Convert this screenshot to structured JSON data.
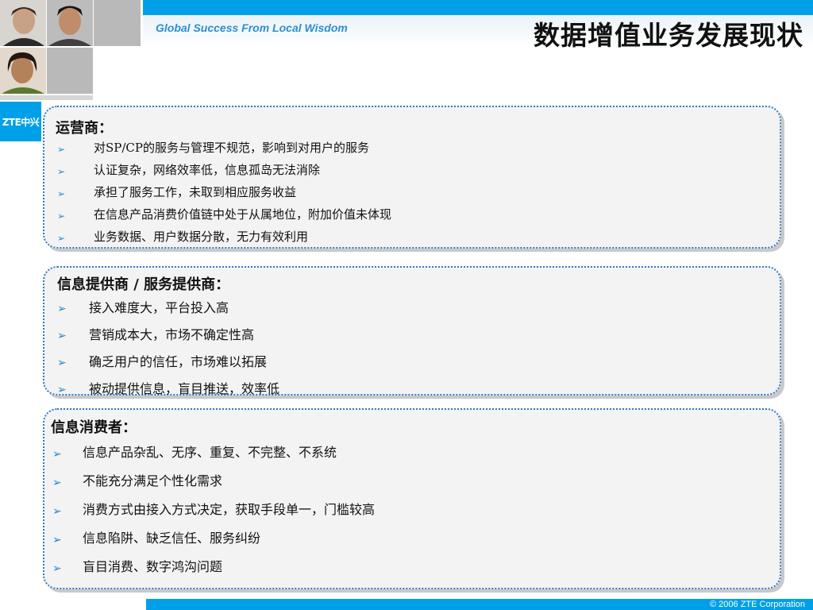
{
  "header": {
    "slogan": "Global Success From Local Wisdom",
    "title": "数据增值业务发展现状",
    "logo_text": "ZTE中兴"
  },
  "panels": [
    {
      "title": "运营商：",
      "items": [
        "对SP/CP的服务与管理不规范，影响到对用户的服务",
        "认证复杂，网络效率低，信息孤岛无法消除",
        "承担了服务工作，未取到相应服务收益",
        "在信息产品消费价值链中处于从属地位，附加价值未体现",
        "业务数据、用户数据分散，无力有效利用"
      ]
    },
    {
      "title": "信息提供商 / 服务提供商：",
      "items": [
        "接入难度大，平台投入高",
        "营销成本大，市场不确定性高",
        "确乏用户的信任，市场难以拓展",
        "被动提供信息，盲目推送，效率低"
      ]
    },
    {
      "title": "信息消费者：",
      "items": [
        "信息产品杂乱、无序、重复、不完整、不系统",
        "不能充分满足个性化需求",
        "消费方式由接入方式决定，获取手段单一，门槛较高",
        "信息陷阱、缺乏信任、服务纠纷",
        "盲目消费、数字鸿沟问题"
      ]
    }
  ],
  "bullet_glyph": "➢",
  "footer": {
    "copyright": "© 2006 ZTE Corporation"
  },
  "colors": {
    "accent_blue": "#00a0e9",
    "panel_border": "#2f79c8",
    "panel_bg": "#f3f3f3",
    "bullet": "#1f86cf"
  }
}
